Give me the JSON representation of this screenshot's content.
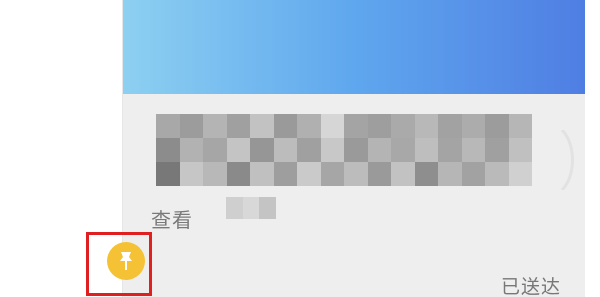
{
  "message_card": {
    "view_link_label": "查看",
    "pixelated_note": "",
    "colors": {
      "banner_start": "#8dd0f1",
      "banner_end": "#4f7ee3",
      "body": "#eeeeee"
    }
  },
  "pin": {
    "icon": "pin-icon",
    "color": "#f6c235",
    "highlight_color": "#e02020"
  },
  "status": {
    "delivered_label": "已送达"
  }
}
